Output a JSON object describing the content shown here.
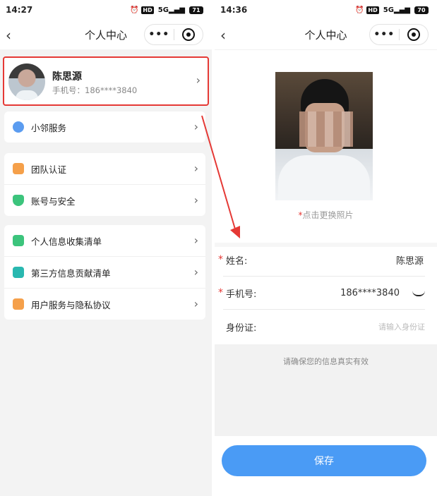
{
  "left": {
    "status": {
      "time": "14:27",
      "battery": "71",
      "hd": "HD",
      "net": "5G"
    },
    "nav": {
      "title": "个人中心",
      "back": "‹",
      "more": "•••"
    },
    "profile": {
      "name": "陈思源",
      "phone": "手机号：186****3840"
    },
    "groups": [
      [
        {
          "label": "小邻服务",
          "icon_color": "#5b9cf0"
        }
      ],
      [
        {
          "label": "团队认证",
          "icon_color": "#f5a04a"
        },
        {
          "label": "账号与安全",
          "icon_color": "#3cc47c"
        }
      ],
      [
        {
          "label": "个人信息收集清单",
          "icon_color": "#3cc47c"
        },
        {
          "label": "第三方信息贡献清单",
          "icon_color": "#29b8b0"
        },
        {
          "label": "用户服务与隐私协议",
          "icon_color": "#f5a04a"
        }
      ]
    ]
  },
  "right": {
    "status": {
      "time": "14:36",
      "battery": "70",
      "hd": "HD",
      "net": "5G"
    },
    "nav": {
      "title": "个人中心",
      "back": "‹",
      "more": "•••"
    },
    "photo_hint": "点击更换照片",
    "form": {
      "name_label": "姓名:",
      "name_value": "陈思源",
      "phone_label": "手机号:",
      "phone_value": "186****3840",
      "id_label": "身份证:",
      "id_placeholder": "请输入身份证"
    },
    "notice": "请确保您的信息真实有效",
    "save": "保存"
  },
  "colors": {
    "highlight": "#e53935",
    "primary": "#4a9bf5"
  }
}
